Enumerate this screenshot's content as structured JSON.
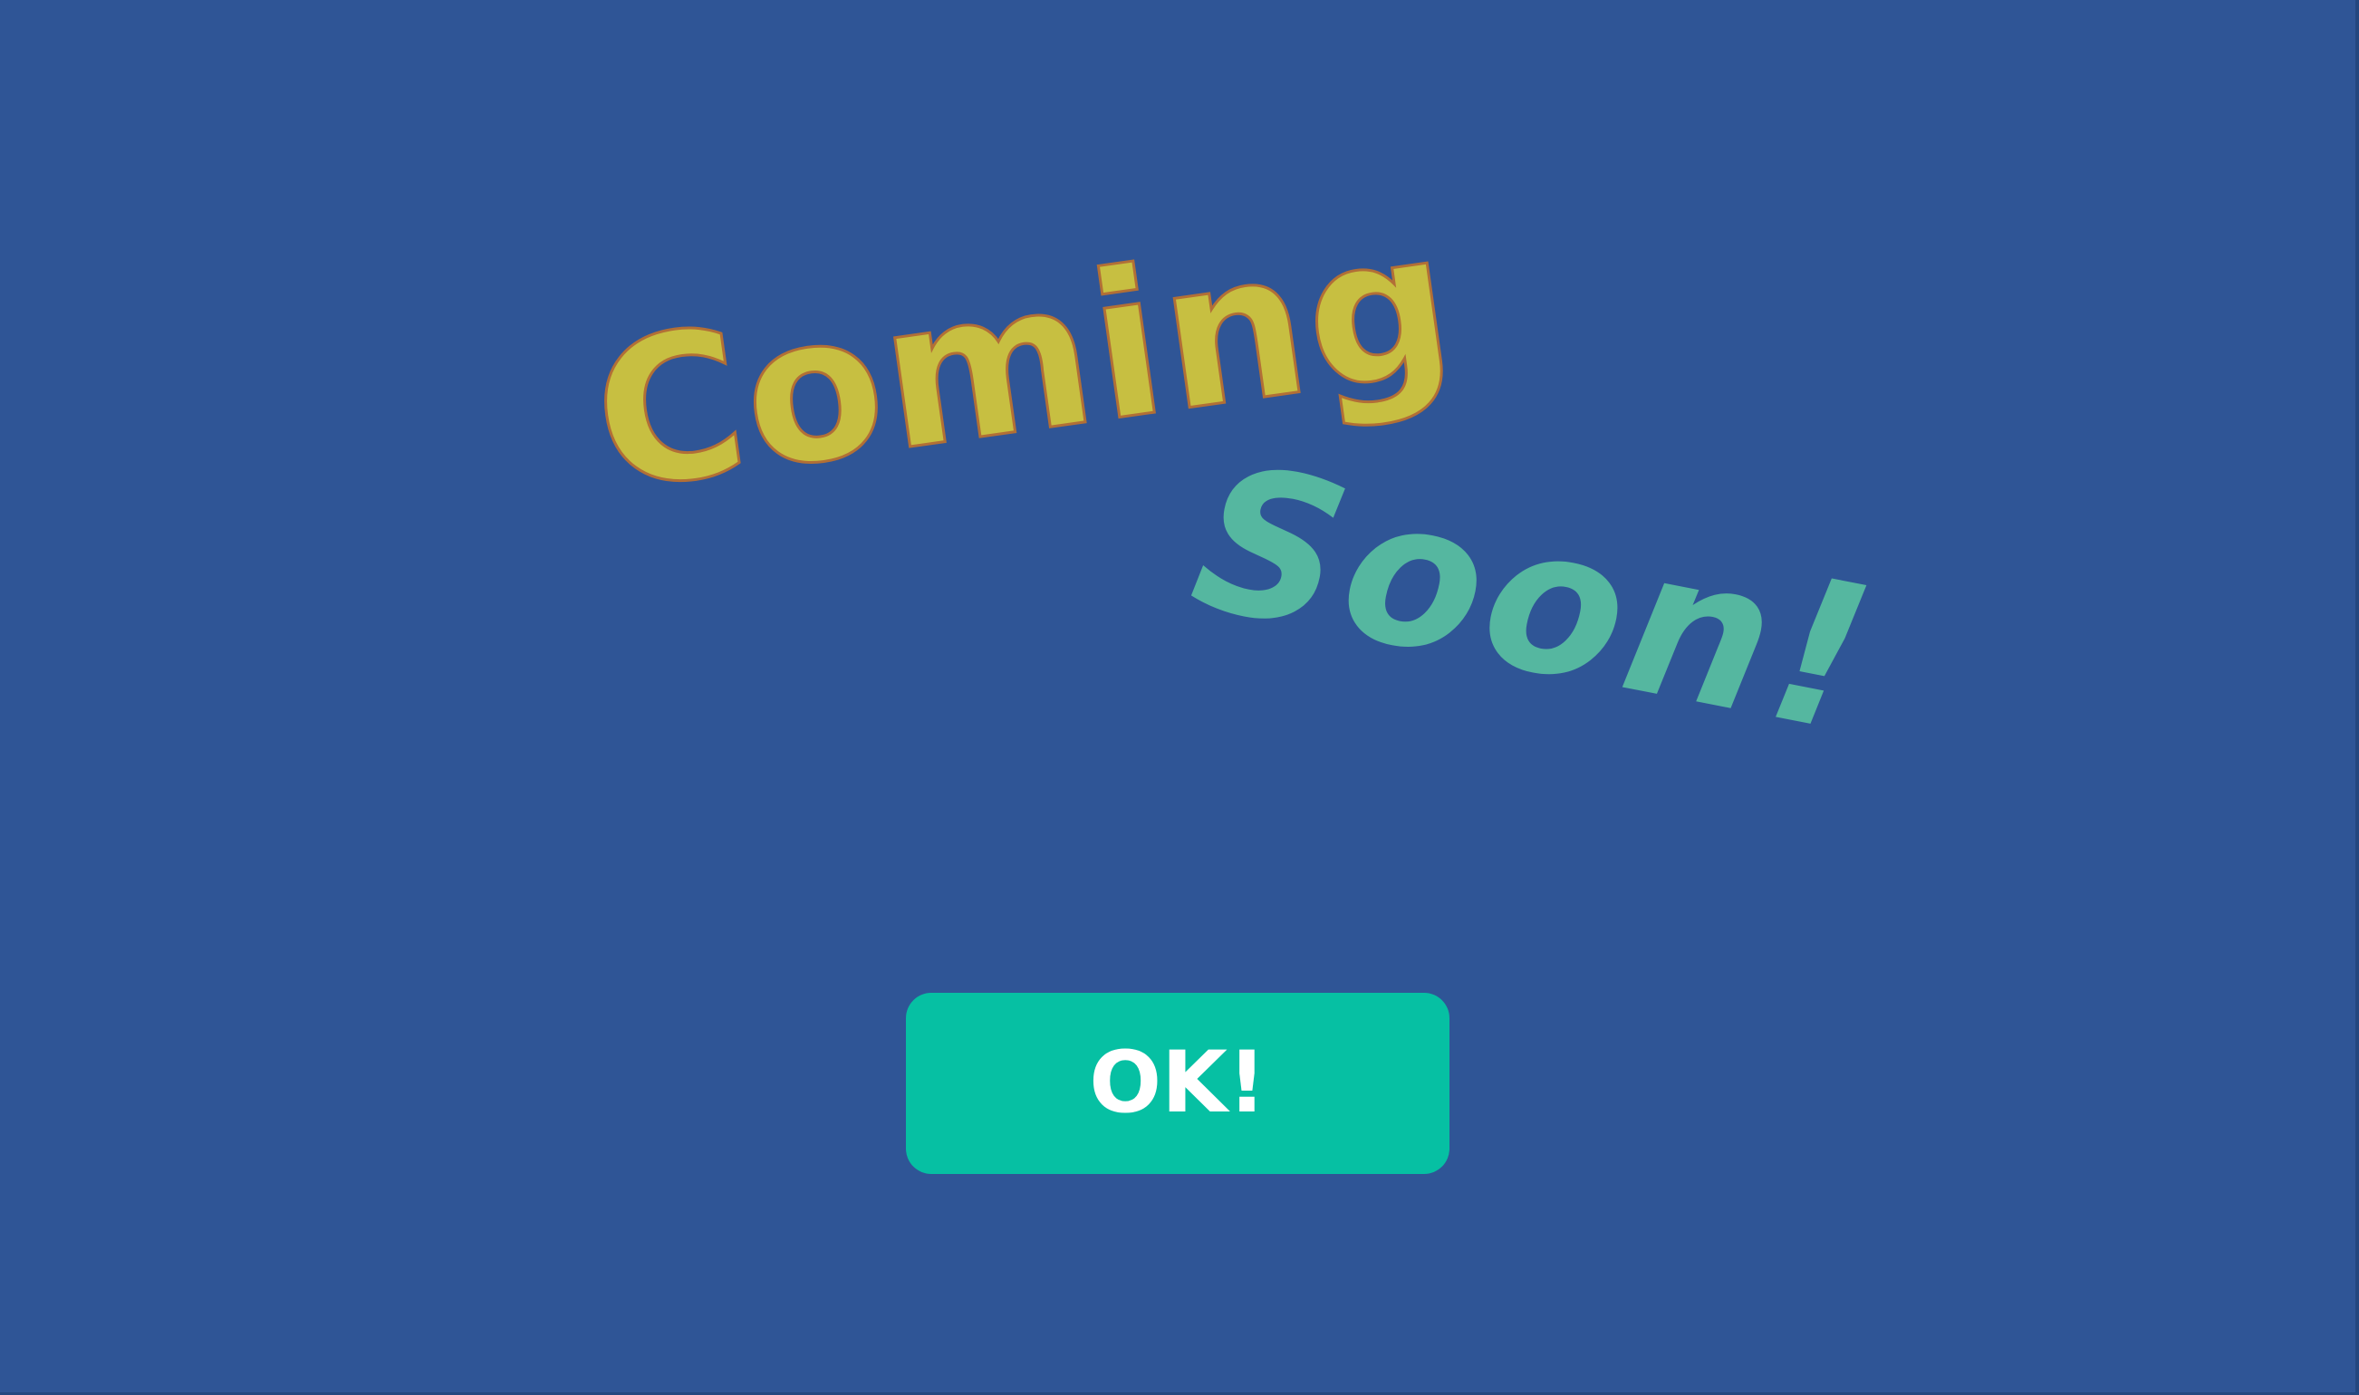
{
  "headline": {
    "line1": "Coming",
    "line2": "Soon!"
  },
  "dialog": {
    "ok_label": "OK!"
  },
  "colors": {
    "background": "#2f5596",
    "coming_fill": "#c7bf41",
    "coming_outline": "#b26f36",
    "soon_fill": "#55b7a0",
    "button_fill": "#06c0a3",
    "button_text": "#ffffff"
  }
}
